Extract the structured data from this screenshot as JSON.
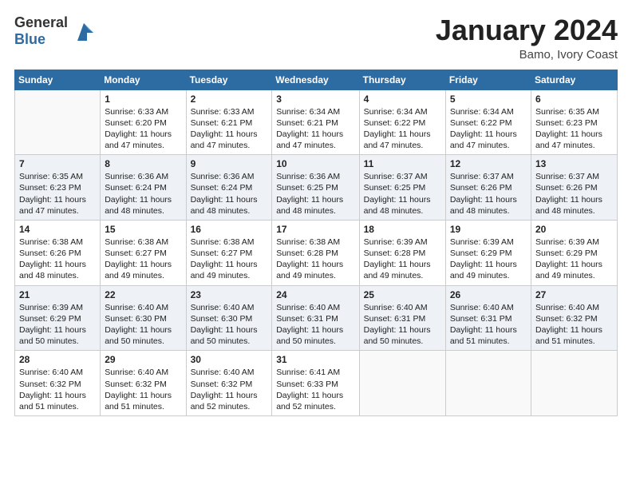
{
  "header": {
    "logo_line1": "General",
    "logo_line2": "Blue",
    "month_title": "January 2024",
    "location": "Bamo, Ivory Coast"
  },
  "days_of_week": [
    "Sunday",
    "Monday",
    "Tuesday",
    "Wednesday",
    "Thursday",
    "Friday",
    "Saturday"
  ],
  "weeks": [
    [
      {
        "day": "",
        "info": ""
      },
      {
        "day": "1",
        "info": "Sunrise: 6:33 AM\nSunset: 6:20 PM\nDaylight: 11 hours\nand 47 minutes."
      },
      {
        "day": "2",
        "info": "Sunrise: 6:33 AM\nSunset: 6:21 PM\nDaylight: 11 hours\nand 47 minutes."
      },
      {
        "day": "3",
        "info": "Sunrise: 6:34 AM\nSunset: 6:21 PM\nDaylight: 11 hours\nand 47 minutes."
      },
      {
        "day": "4",
        "info": "Sunrise: 6:34 AM\nSunset: 6:22 PM\nDaylight: 11 hours\nand 47 minutes."
      },
      {
        "day": "5",
        "info": "Sunrise: 6:34 AM\nSunset: 6:22 PM\nDaylight: 11 hours\nand 47 minutes."
      },
      {
        "day": "6",
        "info": "Sunrise: 6:35 AM\nSunset: 6:23 PM\nDaylight: 11 hours\nand 47 minutes."
      }
    ],
    [
      {
        "day": "7",
        "info": "Sunrise: 6:35 AM\nSunset: 6:23 PM\nDaylight: 11 hours\nand 47 minutes."
      },
      {
        "day": "8",
        "info": "Sunrise: 6:36 AM\nSunset: 6:24 PM\nDaylight: 11 hours\nand 48 minutes."
      },
      {
        "day": "9",
        "info": "Sunrise: 6:36 AM\nSunset: 6:24 PM\nDaylight: 11 hours\nand 48 minutes."
      },
      {
        "day": "10",
        "info": "Sunrise: 6:36 AM\nSunset: 6:25 PM\nDaylight: 11 hours\nand 48 minutes."
      },
      {
        "day": "11",
        "info": "Sunrise: 6:37 AM\nSunset: 6:25 PM\nDaylight: 11 hours\nand 48 minutes."
      },
      {
        "day": "12",
        "info": "Sunrise: 6:37 AM\nSunset: 6:26 PM\nDaylight: 11 hours\nand 48 minutes."
      },
      {
        "day": "13",
        "info": "Sunrise: 6:37 AM\nSunset: 6:26 PM\nDaylight: 11 hours\nand 48 minutes."
      }
    ],
    [
      {
        "day": "14",
        "info": "Sunrise: 6:38 AM\nSunset: 6:26 PM\nDaylight: 11 hours\nand 48 minutes."
      },
      {
        "day": "15",
        "info": "Sunrise: 6:38 AM\nSunset: 6:27 PM\nDaylight: 11 hours\nand 49 minutes."
      },
      {
        "day": "16",
        "info": "Sunrise: 6:38 AM\nSunset: 6:27 PM\nDaylight: 11 hours\nand 49 minutes."
      },
      {
        "day": "17",
        "info": "Sunrise: 6:38 AM\nSunset: 6:28 PM\nDaylight: 11 hours\nand 49 minutes."
      },
      {
        "day": "18",
        "info": "Sunrise: 6:39 AM\nSunset: 6:28 PM\nDaylight: 11 hours\nand 49 minutes."
      },
      {
        "day": "19",
        "info": "Sunrise: 6:39 AM\nSunset: 6:29 PM\nDaylight: 11 hours\nand 49 minutes."
      },
      {
        "day": "20",
        "info": "Sunrise: 6:39 AM\nSunset: 6:29 PM\nDaylight: 11 hours\nand 49 minutes."
      }
    ],
    [
      {
        "day": "21",
        "info": "Sunrise: 6:39 AM\nSunset: 6:29 PM\nDaylight: 11 hours\nand 50 minutes."
      },
      {
        "day": "22",
        "info": "Sunrise: 6:40 AM\nSunset: 6:30 PM\nDaylight: 11 hours\nand 50 minutes."
      },
      {
        "day": "23",
        "info": "Sunrise: 6:40 AM\nSunset: 6:30 PM\nDaylight: 11 hours\nand 50 minutes."
      },
      {
        "day": "24",
        "info": "Sunrise: 6:40 AM\nSunset: 6:31 PM\nDaylight: 11 hours\nand 50 minutes."
      },
      {
        "day": "25",
        "info": "Sunrise: 6:40 AM\nSunset: 6:31 PM\nDaylight: 11 hours\nand 50 minutes."
      },
      {
        "day": "26",
        "info": "Sunrise: 6:40 AM\nSunset: 6:31 PM\nDaylight: 11 hours\nand 51 minutes."
      },
      {
        "day": "27",
        "info": "Sunrise: 6:40 AM\nSunset: 6:32 PM\nDaylight: 11 hours\nand 51 minutes."
      }
    ],
    [
      {
        "day": "28",
        "info": "Sunrise: 6:40 AM\nSunset: 6:32 PM\nDaylight: 11 hours\nand 51 minutes."
      },
      {
        "day": "29",
        "info": "Sunrise: 6:40 AM\nSunset: 6:32 PM\nDaylight: 11 hours\nand 51 minutes."
      },
      {
        "day": "30",
        "info": "Sunrise: 6:40 AM\nSunset: 6:32 PM\nDaylight: 11 hours\nand 52 minutes."
      },
      {
        "day": "31",
        "info": "Sunrise: 6:41 AM\nSunset: 6:33 PM\nDaylight: 11 hours\nand 52 minutes."
      },
      {
        "day": "",
        "info": ""
      },
      {
        "day": "",
        "info": ""
      },
      {
        "day": "",
        "info": ""
      }
    ]
  ]
}
